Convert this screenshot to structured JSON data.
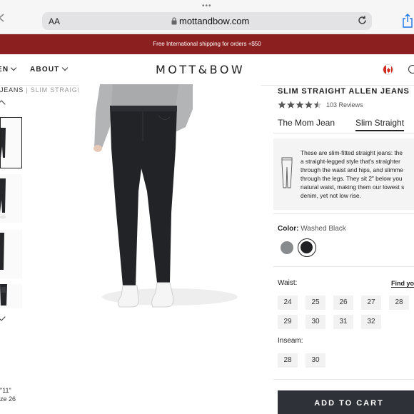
{
  "browser": {
    "text_size_label": "AA",
    "url": "mottandbow.com"
  },
  "promo": {
    "text": "Free International shipping for orders +$50"
  },
  "nav": {
    "items": [
      {
        "label": "EN"
      },
      {
        "label": "ABOUT"
      }
    ],
    "logo": "MOTT&BOW"
  },
  "breadcrumb": {
    "parent": "JEANS",
    "separator": " | ",
    "current": "SLIM STRAIGHT"
  },
  "model_info": {
    "height": "\"11\"",
    "size": "ze 26"
  },
  "product": {
    "title": "SLIM STRAIGHT ALLEN JEANS",
    "rating": 4.5,
    "reviews": "103 Reviews",
    "styles": [
      {
        "label": "The Mom Jean",
        "active": false
      },
      {
        "label": "Slim Straight",
        "active": true
      }
    ],
    "description": "These are slim-fitted straight jeans: the\na straight-legged style that's straighter\nthrough the waist and hips, and slimme\nthrough the legs. They sit 2\" below you\nnatural waist, making them our lowest s\ndenim, yet not low rise.",
    "color_label": "Color:",
    "color_value": "Washed Black",
    "swatches": [
      {
        "name": "grey",
        "color": "#888b8d",
        "selected": false
      },
      {
        "name": "washed-black",
        "color": "#202124",
        "selected": true
      }
    ],
    "waist_label": "Waist:",
    "find_fit": "Find yo",
    "waist_sizes": [
      "24",
      "25",
      "26",
      "27",
      "28",
      "29",
      "30",
      "31",
      "32"
    ],
    "inseam_label": "Inseam:",
    "inseam_sizes": [
      "28",
      "30"
    ],
    "add_to_cart": "ADD TO CART"
  },
  "colors": {
    "promo_bg": "#8b1e1e",
    "cart_bg": "#2e3238"
  }
}
